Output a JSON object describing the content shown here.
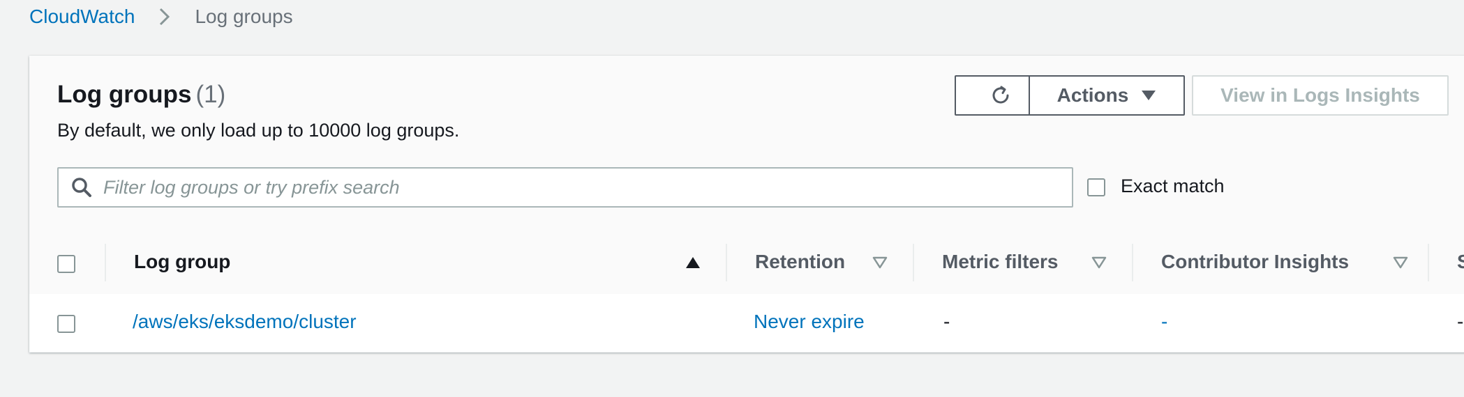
{
  "breadcrumb": {
    "items": [
      "CloudWatch",
      "Log groups"
    ]
  },
  "panel": {
    "title": "Log groups",
    "count": "(1)",
    "subtitle": "By default, we only load up to 10000 log groups.",
    "actions_label": "Actions",
    "insights_label": "View in Logs Insights"
  },
  "search": {
    "placeholder": "Filter log groups or try prefix search"
  },
  "exact_match": {
    "label": "Exact match",
    "checked": false
  },
  "table": {
    "columns": [
      "Log group",
      "Retention",
      "Metric filters",
      "Contributor Insights",
      "S"
    ],
    "rows": [
      {
        "log_group": "/aws/eks/eksdemo/cluster",
        "retention": "Never expire",
        "metric_filters": "-",
        "contributor_insights": "-",
        "extra": "-"
      }
    ]
  },
  "colors": {
    "link": "#0073bb",
    "text": "#16191f",
    "muted": "#687078",
    "page_bg": "#f2f3f3"
  }
}
